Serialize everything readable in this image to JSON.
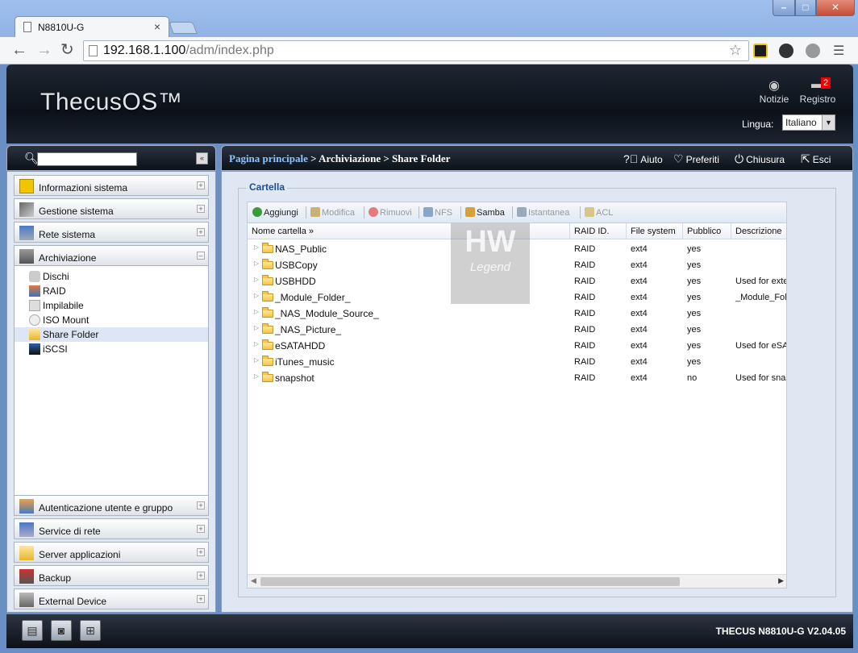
{
  "browser": {
    "tab_title": "N8810U-G",
    "tab_close": "×",
    "url_host": "192.168.1.100",
    "url_path": "/adm/index.php",
    "controls": {
      "minimize": "–",
      "maximize": "□",
      "close": "✕"
    }
  },
  "header": {
    "logo": "ThecusOS™",
    "notizie": "Notizie",
    "registro": "Registro",
    "registro_badge": "2",
    "lingua_label": "Lingua:",
    "lingua_value": "Italiano"
  },
  "sidebar": {
    "search_placeholder": "",
    "sections_top": [
      {
        "label": "Informazioni sistema",
        "icon": "info-icon",
        "toggle": "+"
      },
      {
        "label": "Gestione sistema",
        "icon": "tools-icon",
        "toggle": "+"
      },
      {
        "label": "Rete sistema",
        "icon": "network-icon",
        "toggle": "+"
      },
      {
        "label": "Archiviazione",
        "icon": "storage-icon",
        "toggle": "–"
      }
    ],
    "storage_items": [
      {
        "label": "Dischi",
        "icon": "disk-icon"
      },
      {
        "label": "RAID",
        "icon": "raid-icon"
      },
      {
        "label": "Impilabile",
        "icon": "stack-icon"
      },
      {
        "label": "ISO Mount",
        "icon": "iso-icon"
      },
      {
        "label": "Share Folder",
        "icon": "folder-icon",
        "selected": true
      },
      {
        "label": "iSCSI",
        "icon": "iscsi-icon"
      }
    ],
    "sections_bottom": [
      {
        "label": "Autenticazione utente e gruppo",
        "icon": "users-icon",
        "toggle": "+"
      },
      {
        "label": "Service di rete",
        "icon": "network-service-icon",
        "toggle": "+"
      },
      {
        "label": "Server applicazioni",
        "icon": "app-server-icon",
        "toggle": "+"
      },
      {
        "label": "Backup",
        "icon": "backup-icon",
        "toggle": "+"
      },
      {
        "label": "External Device",
        "icon": "external-device-icon",
        "toggle": "+"
      }
    ]
  },
  "breadcrumb": {
    "home": "Pagina principale",
    "sep": ">",
    "level1": "Archiviazione",
    "level2": "Share Folder"
  },
  "toplinks": {
    "aiuto": "Aiuto",
    "preferiti": "Preferiti",
    "chiusura": "Chiusura",
    "esci": "Esci"
  },
  "panel": {
    "legend": "Cartella",
    "toolbar": [
      {
        "label": "Aggiungi",
        "enabled": true,
        "color": "#3a9b3a"
      },
      {
        "label": "Modifica",
        "enabled": false,
        "color": "#c9b27a"
      },
      {
        "label": "Rimuovi",
        "enabled": false,
        "color": "#e57a7a"
      },
      {
        "label": "NFS",
        "enabled": false,
        "color": "#8aa6c9"
      },
      {
        "label": "Samba",
        "enabled": true,
        "color": "#d6a03a"
      },
      {
        "label": "Istantanea",
        "enabled": false,
        "color": "#9aa9bd"
      },
      {
        "label": "ACL",
        "enabled": false,
        "color": "#d9c48a"
      }
    ],
    "columns": [
      "Nome cartella »",
      "RAID ID.",
      "File system",
      "Pubblico",
      "Descrizione"
    ],
    "rows": [
      {
        "name": "NAS_Public",
        "raid": "RAID",
        "fs": "ext4",
        "pub": "yes",
        "desc": ""
      },
      {
        "name": "USBCopy",
        "raid": "RAID",
        "fs": "ext4",
        "pub": "yes",
        "desc": ""
      },
      {
        "name": "USBHDD",
        "raid": "RAID",
        "fs": "ext4",
        "pub": "yes",
        "desc": "Used for exte"
      },
      {
        "name": "_Module_Folder_",
        "raid": "RAID",
        "fs": "ext4",
        "pub": "yes",
        "desc": "_Module_Fold"
      },
      {
        "name": "_NAS_Module_Source_",
        "raid": "RAID",
        "fs": "ext4",
        "pub": "yes",
        "desc": ""
      },
      {
        "name": "_NAS_Picture_",
        "raid": "RAID",
        "fs": "ext4",
        "pub": "yes",
        "desc": ""
      },
      {
        "name": "eSATAHDD",
        "raid": "RAID",
        "fs": "ext4",
        "pub": "yes",
        "desc": "Used for eSA"
      },
      {
        "name": "iTunes_music",
        "raid": "RAID",
        "fs": "ext4",
        "pub": "yes",
        "desc": ""
      },
      {
        "name": "snapshot",
        "raid": "RAID",
        "fs": "ext4",
        "pub": "no",
        "desc": "Used for sna"
      }
    ],
    "watermark_top": "HW",
    "watermark_bottom": "Legend"
  },
  "footer": {
    "version": "THECUS N8810U-G V2.04.05"
  }
}
